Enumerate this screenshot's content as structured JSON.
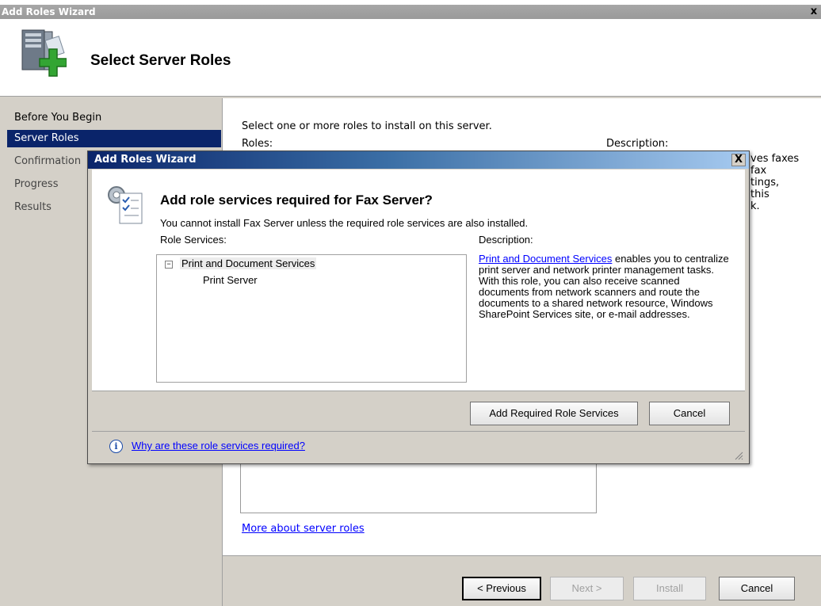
{
  "main_window": {
    "title": "Add Roles Wizard",
    "close_glyph": "x",
    "header_title": "Select Server Roles",
    "header_icon": "server-add-icon"
  },
  "nav": {
    "items": [
      {
        "label": "Before You Begin",
        "state": "normal"
      },
      {
        "label": "Server Roles",
        "state": "active"
      },
      {
        "label": "Confirmation",
        "state": "dim"
      },
      {
        "label": "Progress",
        "state": "dim"
      },
      {
        "label": "Results",
        "state": "dim"
      }
    ]
  },
  "content": {
    "instruction": "Select one or more roles to install on this server.",
    "roles_label": "Roles:",
    "description_label": "Description:",
    "description_partial_lines": [
      "ves faxes",
      "fax",
      "tings,",
      "this",
      "k."
    ],
    "more_link": "More about server roles"
  },
  "footer_buttons": {
    "previous": "< Previous",
    "next": "Next >",
    "install": "Install",
    "cancel": "Cancel"
  },
  "dialog": {
    "title": "Add Roles Wizard",
    "close_glyph": "X",
    "heading": "Add role services required for Fax Server?",
    "subtext": "You cannot install Fax Server unless the required role services are also installed.",
    "role_services_label": "Role Services:",
    "tree": {
      "expander": "−",
      "parent": "Print and Document Services",
      "child": "Print Server"
    },
    "description_label": "Description:",
    "description_link": "Print and Document Services",
    "description_text": " enables you to centralize print server and network printer management tasks. With this role, you can also receive scanned documents from network scanners and route the documents to a shared network resource, Windows SharePoint Services site, or e-mail addresses.",
    "add_button": "Add Required Role Services",
    "cancel_button": "Cancel",
    "info_glyph": "i",
    "why_link": "Why are these role services required?"
  },
  "colors": {
    "nav_active": "#0a246a",
    "link": "#0000ff",
    "dialog_title_start": "#0a246a",
    "dialog_title_end": "#a6caf0"
  }
}
